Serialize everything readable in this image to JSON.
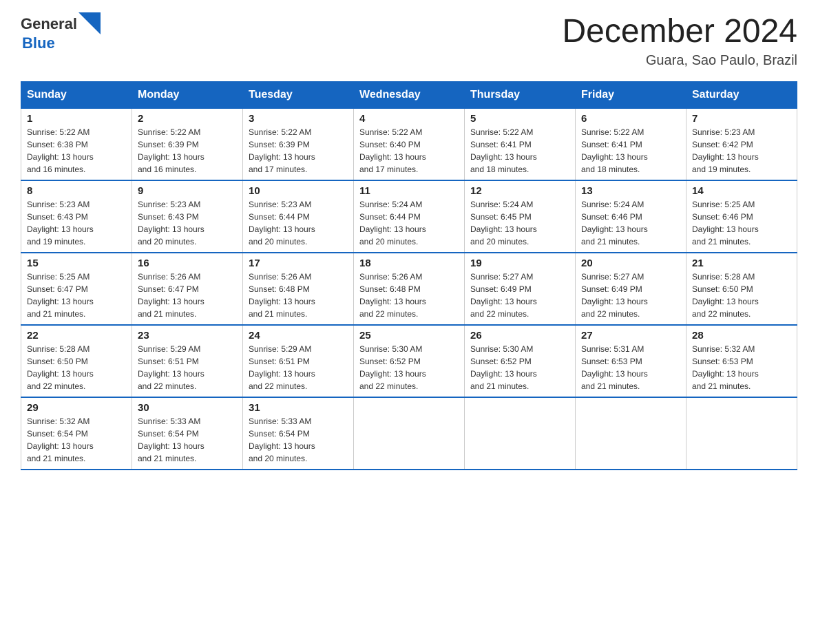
{
  "header": {
    "logo_general": "General",
    "logo_blue": "Blue",
    "month": "December 2024",
    "location": "Guara, Sao Paulo, Brazil"
  },
  "weekdays": [
    "Sunday",
    "Monday",
    "Tuesday",
    "Wednesday",
    "Thursday",
    "Friday",
    "Saturday"
  ],
  "weeks": [
    [
      {
        "day": "1",
        "sunrise": "5:22 AM",
        "sunset": "6:38 PM",
        "daylight": "13 hours and 16 minutes."
      },
      {
        "day": "2",
        "sunrise": "5:22 AM",
        "sunset": "6:39 PM",
        "daylight": "13 hours and 16 minutes."
      },
      {
        "day": "3",
        "sunrise": "5:22 AM",
        "sunset": "6:39 PM",
        "daylight": "13 hours and 17 minutes."
      },
      {
        "day": "4",
        "sunrise": "5:22 AM",
        "sunset": "6:40 PM",
        "daylight": "13 hours and 17 minutes."
      },
      {
        "day": "5",
        "sunrise": "5:22 AM",
        "sunset": "6:41 PM",
        "daylight": "13 hours and 18 minutes."
      },
      {
        "day": "6",
        "sunrise": "5:22 AM",
        "sunset": "6:41 PM",
        "daylight": "13 hours and 18 minutes."
      },
      {
        "day": "7",
        "sunrise": "5:23 AM",
        "sunset": "6:42 PM",
        "daylight": "13 hours and 19 minutes."
      }
    ],
    [
      {
        "day": "8",
        "sunrise": "5:23 AM",
        "sunset": "6:43 PM",
        "daylight": "13 hours and 19 minutes."
      },
      {
        "day": "9",
        "sunrise": "5:23 AM",
        "sunset": "6:43 PM",
        "daylight": "13 hours and 20 minutes."
      },
      {
        "day": "10",
        "sunrise": "5:23 AM",
        "sunset": "6:44 PM",
        "daylight": "13 hours and 20 minutes."
      },
      {
        "day": "11",
        "sunrise": "5:24 AM",
        "sunset": "6:44 PM",
        "daylight": "13 hours and 20 minutes."
      },
      {
        "day": "12",
        "sunrise": "5:24 AM",
        "sunset": "6:45 PM",
        "daylight": "13 hours and 20 minutes."
      },
      {
        "day": "13",
        "sunrise": "5:24 AM",
        "sunset": "6:46 PM",
        "daylight": "13 hours and 21 minutes."
      },
      {
        "day": "14",
        "sunrise": "5:25 AM",
        "sunset": "6:46 PM",
        "daylight": "13 hours and 21 minutes."
      }
    ],
    [
      {
        "day": "15",
        "sunrise": "5:25 AM",
        "sunset": "6:47 PM",
        "daylight": "13 hours and 21 minutes."
      },
      {
        "day": "16",
        "sunrise": "5:26 AM",
        "sunset": "6:47 PM",
        "daylight": "13 hours and 21 minutes."
      },
      {
        "day": "17",
        "sunrise": "5:26 AM",
        "sunset": "6:48 PM",
        "daylight": "13 hours and 21 minutes."
      },
      {
        "day": "18",
        "sunrise": "5:26 AM",
        "sunset": "6:48 PM",
        "daylight": "13 hours and 22 minutes."
      },
      {
        "day": "19",
        "sunrise": "5:27 AM",
        "sunset": "6:49 PM",
        "daylight": "13 hours and 22 minutes."
      },
      {
        "day": "20",
        "sunrise": "5:27 AM",
        "sunset": "6:49 PM",
        "daylight": "13 hours and 22 minutes."
      },
      {
        "day": "21",
        "sunrise": "5:28 AM",
        "sunset": "6:50 PM",
        "daylight": "13 hours and 22 minutes."
      }
    ],
    [
      {
        "day": "22",
        "sunrise": "5:28 AM",
        "sunset": "6:50 PM",
        "daylight": "13 hours and 22 minutes."
      },
      {
        "day": "23",
        "sunrise": "5:29 AM",
        "sunset": "6:51 PM",
        "daylight": "13 hours and 22 minutes."
      },
      {
        "day": "24",
        "sunrise": "5:29 AM",
        "sunset": "6:51 PM",
        "daylight": "13 hours and 22 minutes."
      },
      {
        "day": "25",
        "sunrise": "5:30 AM",
        "sunset": "6:52 PM",
        "daylight": "13 hours and 22 minutes."
      },
      {
        "day": "26",
        "sunrise": "5:30 AM",
        "sunset": "6:52 PM",
        "daylight": "13 hours and 21 minutes."
      },
      {
        "day": "27",
        "sunrise": "5:31 AM",
        "sunset": "6:53 PM",
        "daylight": "13 hours and 21 minutes."
      },
      {
        "day": "28",
        "sunrise": "5:32 AM",
        "sunset": "6:53 PM",
        "daylight": "13 hours and 21 minutes."
      }
    ],
    [
      {
        "day": "29",
        "sunrise": "5:32 AM",
        "sunset": "6:54 PM",
        "daylight": "13 hours and 21 minutes."
      },
      {
        "day": "30",
        "sunrise": "5:33 AM",
        "sunset": "6:54 PM",
        "daylight": "13 hours and 21 minutes."
      },
      {
        "day": "31",
        "sunrise": "5:33 AM",
        "sunset": "6:54 PM",
        "daylight": "13 hours and 20 minutes."
      },
      null,
      null,
      null,
      null
    ]
  ],
  "labels": {
    "sunrise": "Sunrise:",
    "sunset": "Sunset:",
    "daylight": "Daylight:"
  }
}
